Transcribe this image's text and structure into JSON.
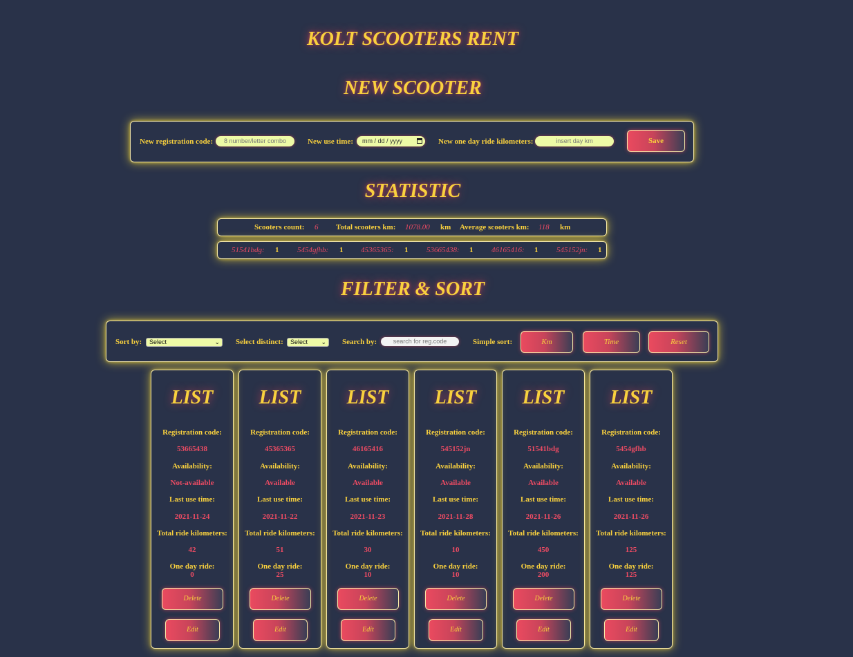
{
  "header": {
    "app_title": "KOLT SCOOTERS RENT",
    "new_section_title": "NEW SCOOTER",
    "statistic_title": "STATISTIC",
    "filter_title": "FILTER & SORT"
  },
  "new_scooter": {
    "reg_label": "New registration code:",
    "reg_placeholder": "8 number/letter combo",
    "time_label": "New use time:",
    "time_placeholder": "mm / dd / yyyy",
    "km_label": "New one day ride kilometers:",
    "km_placeholder": "insert day km",
    "save_label": "Save"
  },
  "statistic": {
    "count_label": "Scooters count:",
    "count_value": "6",
    "total_label": "Total scooters km:",
    "total_value": "1078.00",
    "km_unit": "km",
    "avg_label": "Average scooters km:",
    "avg_value": "118",
    "codes": [
      {
        "code": "51541bdg:",
        "count": "1"
      },
      {
        "code": "5454gfhb:",
        "count": "1"
      },
      {
        "code": "45365365:",
        "count": "1"
      },
      {
        "code": "53665438:",
        "count": "1"
      },
      {
        "code": "46165416:",
        "count": "1"
      },
      {
        "code": "545152jn:",
        "count": "1"
      }
    ]
  },
  "filter": {
    "sort_label": "Sort by:",
    "sort_value": "Select",
    "distinct_label": "Select distinct:",
    "distinct_value": "Select",
    "search_label": "Search by:",
    "search_placeholder": "search for reg.code",
    "simple_label": "Simple sort:",
    "km_button": "Km",
    "time_button": "Time",
    "reset_button": "Reset"
  },
  "list": {
    "title": "LIST",
    "reg_label": "Registration code:",
    "avail_label": "Availability:",
    "last_label": "Last use time:",
    "total_label": "Total ride kilometers:",
    "oneday_label": "One day ride:",
    "delete_label": "Delete",
    "edit_label": "Edit",
    "items": [
      {
        "code": "53665438",
        "availability": "Not-available",
        "last_use": "2021-11-24",
        "total_km": "42",
        "one_day": "0"
      },
      {
        "code": "45365365",
        "availability": "Available",
        "last_use": "2021-11-22",
        "total_km": "51",
        "one_day": "25"
      },
      {
        "code": "46165416",
        "availability": "Available",
        "last_use": "2021-11-23",
        "total_km": "30",
        "one_day": "10"
      },
      {
        "code": "545152jn",
        "availability": "Available",
        "last_use": "2021-11-28",
        "total_km": "10",
        "one_day": "10"
      },
      {
        "code": "51541bdg",
        "availability": "Available",
        "last_use": "2021-11-26",
        "total_km": "450",
        "one_day": "200"
      },
      {
        "code": "5454gfhb",
        "availability": "Available",
        "last_use": "2021-11-26",
        "total_km": "125",
        "one_day": "125"
      }
    ]
  }
}
